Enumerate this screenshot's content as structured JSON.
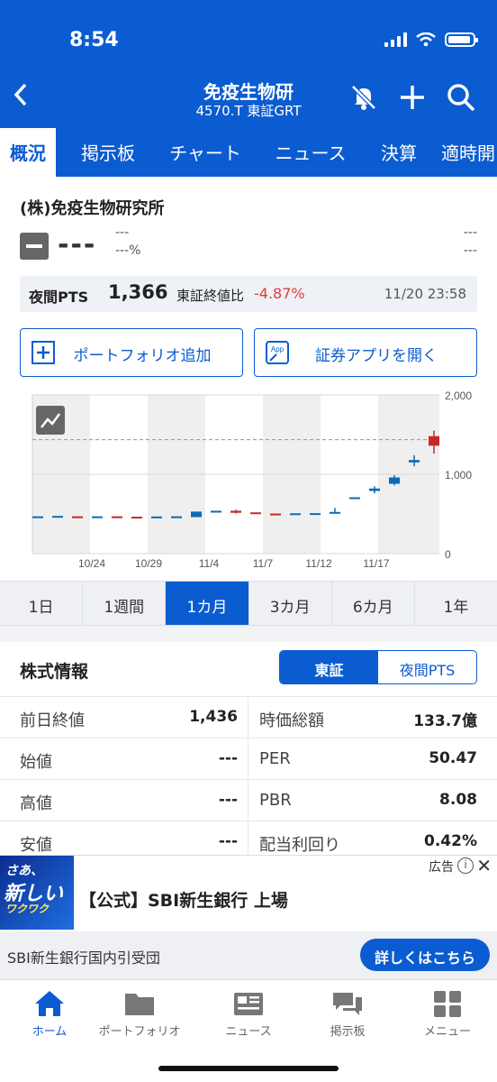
{
  "status": {
    "time": "8:54"
  },
  "header": {
    "title": "免疫生物研",
    "subtitle": "4570.T 東証GRT"
  },
  "tabs": [
    "概況",
    "掲示板",
    "チャート",
    "ニュース",
    "決算",
    "適時開"
  ],
  "company": {
    "name": "(株)免疫生物研究所",
    "price": "---",
    "change": "---",
    "change_pct": "---%",
    "right_top": "---",
    "right_bottom": "---"
  },
  "pts": {
    "label": "夜間PTS",
    "value": "1,366",
    "compare_label": "東証終値比",
    "change": "-4.87%",
    "datetime": "11/20 23:58"
  },
  "buttons": {
    "portfolio": "ポートフォリオ追加",
    "app": "証券アプリを開く",
    "app_icon_text": "App"
  },
  "chart_data": {
    "type": "candlestick",
    "x_ticks": [
      "10/24",
      "10/29",
      "11/4",
      "11/7",
      "11/12",
      "11/17"
    ],
    "y_ticks": [
      "2,000",
      "1,000",
      "0"
    ],
    "ylim": [
      0,
      2000
    ],
    "reference_line": 1436,
    "candles": [
      {
        "o": 460,
        "c": 470,
        "up": true
      },
      {
        "o": 470,
        "c": 475,
        "up": true
      },
      {
        "o": 470,
        "c": 465,
        "up": false
      },
      {
        "o": 468,
        "c": 470,
        "up": true
      },
      {
        "o": 470,
        "c": 462,
        "up": false
      },
      {
        "o": 465,
        "c": 458,
        "up": false
      },
      {
        "o": 460,
        "c": 468,
        "up": true
      },
      {
        "o": 462,
        "c": 470,
        "up": true
      },
      {
        "o": 460,
        "c": 530,
        "up": true
      },
      {
        "o": 530,
        "c": 540,
        "up": true
      },
      {
        "o": 540,
        "c": 515,
        "up": false,
        "h": 555,
        "l": 505
      },
      {
        "o": 520,
        "c": 505,
        "up": false
      },
      {
        "o": 505,
        "c": 500,
        "up": false
      },
      {
        "o": 500,
        "c": 508,
        "up": true
      },
      {
        "o": 505,
        "c": 510,
        "up": true
      },
      {
        "o": 525,
        "c": 525,
        "up": true,
        "h": 575,
        "l": 505
      },
      {
        "o": 700,
        "c": 710,
        "up": true
      },
      {
        "o": 790,
        "c": 820,
        "up": true,
        "h": 850,
        "l": 760
      },
      {
        "o": 880,
        "c": 960,
        "up": true,
        "h": 990,
        "l": 860
      },
      {
        "o": 1150,
        "c": 1180,
        "up": true,
        "h": 1240,
        "l": 1100
      },
      {
        "o": 1480,
        "c": 1360,
        "up": false,
        "h": 1550,
        "l": 1260
      }
    ]
  },
  "ranges": [
    "1日",
    "1週間",
    "1カ月",
    "3カ月",
    "6カ月",
    "1年"
  ],
  "stock_info": {
    "heading": "株式情報",
    "seg": [
      "東証",
      "夜間PTS"
    ],
    "rows": [
      {
        "l": "前日終値",
        "lv": "1,436",
        "r": "時価総額",
        "rv": "133.7億"
      },
      {
        "l": "始値",
        "lv": "---",
        "r": "PER",
        "rv": "50.47"
      },
      {
        "l": "高値",
        "lv": "---",
        "r": "PBR",
        "rv": "8.08"
      },
      {
        "l": "安値",
        "lv": "---",
        "r": "配当利回り",
        "rv": "0.42%"
      }
    ]
  },
  "ad": {
    "thumb_top": "さあ、",
    "thumb_main": "新しい",
    "thumb_sub": "ワクワク",
    "title": "【公式】SBI新生銀行 上場",
    "label": "広告",
    "sub": "SBI新生銀行国内引受団",
    "cta": "詳しくはこちら"
  },
  "tabbar": [
    "ホーム",
    "ポートフォリオ",
    "ニュース",
    "掲示板",
    "メニュー"
  ],
  "colors": {
    "primary": "#0b5cd0",
    "up": "#0d6bb5",
    "down": "#c62828"
  }
}
